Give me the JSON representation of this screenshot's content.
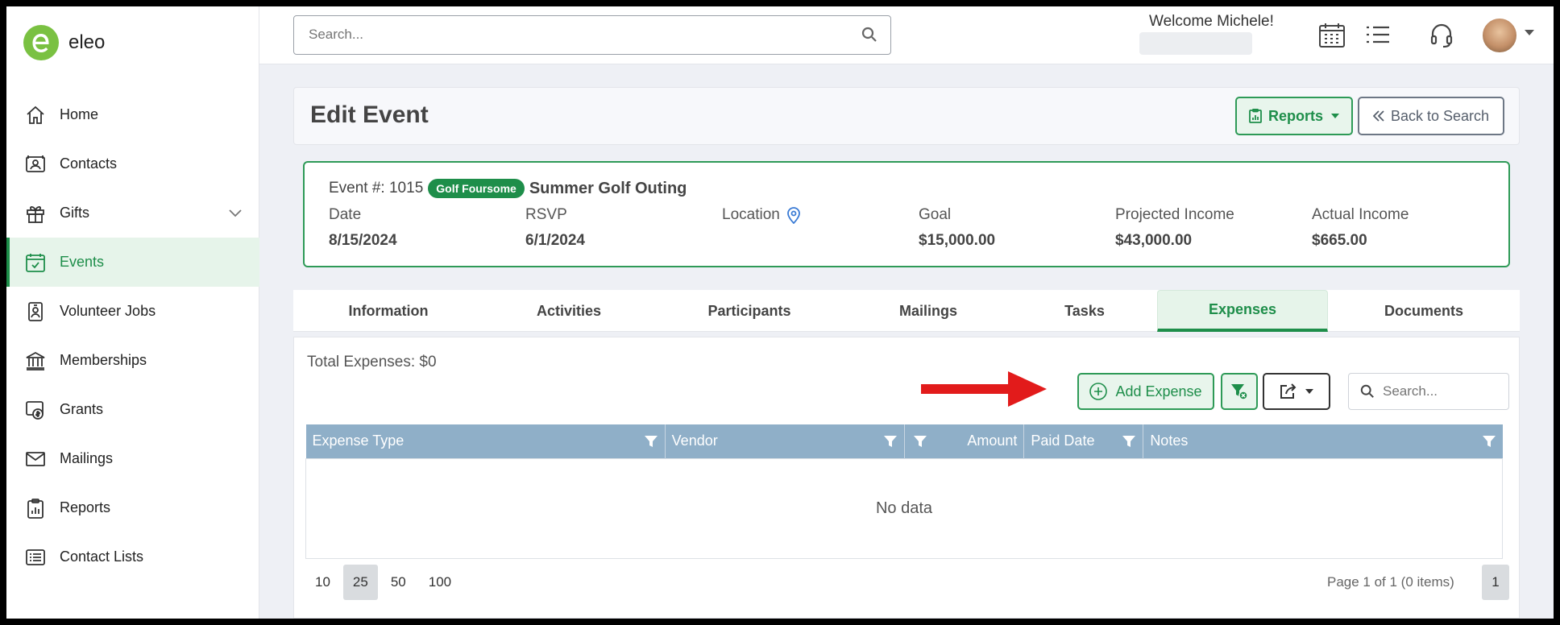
{
  "app": {
    "name": "eleo"
  },
  "sidebar": {
    "items": [
      {
        "label": "Home",
        "icon": "home-icon"
      },
      {
        "label": "Contacts",
        "icon": "contact-card-icon"
      },
      {
        "label": "Gifts",
        "icon": "gift-icon"
      },
      {
        "label": "Events",
        "icon": "calendar-check-icon",
        "active": true
      },
      {
        "label": "Volunteer Jobs",
        "icon": "id-badge-icon"
      },
      {
        "label": "Memberships",
        "icon": "bank-building-icon"
      },
      {
        "label": "Grants",
        "icon": "money-icon"
      },
      {
        "label": "Mailings",
        "icon": "envelope-icon"
      },
      {
        "label": "Reports",
        "icon": "clipboard-chart-icon"
      },
      {
        "label": "Contact Lists",
        "icon": "list-icon"
      }
    ]
  },
  "header": {
    "search_placeholder": "Search...",
    "welcome": "Welcome Michele!"
  },
  "page": {
    "title": "Edit Event",
    "reports_label": "Reports",
    "back_label": "Back to Search"
  },
  "event": {
    "number_label": "Event #: 1015",
    "badge": "Golf Foursome",
    "name": "Summer Golf Outing",
    "stats": [
      {
        "label": "Date",
        "value": "8/15/2024"
      },
      {
        "label": "RSVP",
        "value": "6/1/2024"
      },
      {
        "label": "Location",
        "value": ""
      },
      {
        "label": "Goal",
        "value": "$15,000.00"
      },
      {
        "label": "Projected Income",
        "value": "$43,000.00"
      },
      {
        "label": "Actual Income",
        "value": "$665.00"
      }
    ]
  },
  "tabs": [
    {
      "label": "Information"
    },
    {
      "label": "Activities"
    },
    {
      "label": "Participants"
    },
    {
      "label": "Mailings"
    },
    {
      "label": "Tasks"
    },
    {
      "label": "Expenses",
      "active": true
    },
    {
      "label": "Documents"
    }
  ],
  "expenses": {
    "total_label": "Total Expenses: $0",
    "add_label": "Add Expense",
    "search_placeholder": "Search...",
    "columns": [
      "Expense Type",
      "Vendor",
      "Amount",
      "Paid Date",
      "Notes"
    ],
    "empty_text": "No data",
    "page_sizes": [
      "10",
      "25",
      "50",
      "100"
    ],
    "selected_page_size": "25",
    "page_info": "Page 1 of 1 (0 items)",
    "current_page": "1"
  },
  "colors": {
    "brand_green": "#1e8e4a",
    "logo_green": "#7ac142",
    "table_header": "#8fafc8",
    "arrow_red": "#e21b1b"
  }
}
